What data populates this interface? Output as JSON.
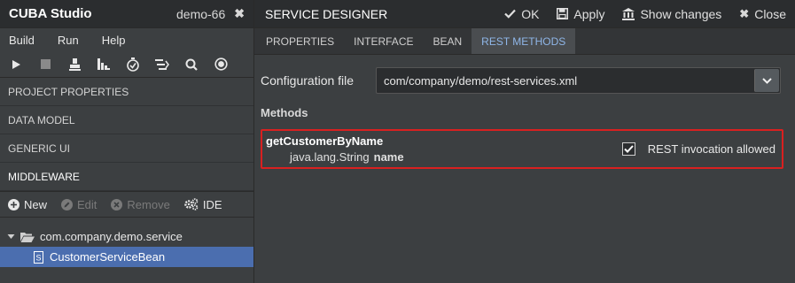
{
  "app": {
    "title": "CUBA Studio",
    "project": "demo-66"
  },
  "menu": [
    "Build",
    "Run",
    "Help"
  ],
  "toolbar_icons": [
    "play-icon",
    "stop-icon",
    "deploy-icon",
    "build-icon",
    "check-icon",
    "list-icon",
    "search-icon",
    "record-icon"
  ],
  "sections": [
    {
      "label": "PROJECT PROPERTIES"
    },
    {
      "label": "DATA MODEL"
    },
    {
      "label": "GENERIC UI"
    },
    {
      "label": "MIDDLEWARE"
    }
  ],
  "middleware_actions": {
    "new": "New",
    "edit": "Edit",
    "remove": "Remove",
    "ide": "IDE"
  },
  "tree": {
    "package": "com.company.demo.service",
    "service": "CustomerServiceBean"
  },
  "designer": {
    "title": "SERVICE DESIGNER",
    "ok": "OK",
    "apply": "Apply",
    "show_changes": "Show changes",
    "close": "Close"
  },
  "tabs": [
    {
      "label": "PROPERTIES"
    },
    {
      "label": "INTERFACE"
    },
    {
      "label": "BEAN"
    },
    {
      "label": "REST METHODS"
    }
  ],
  "config": {
    "label": "Configuration file",
    "value": "com/company/demo/rest-services.xml"
  },
  "methods": {
    "label": "Methods",
    "items": [
      {
        "name": "getCustomerByName",
        "param_type": "java.lang.String",
        "param_name": "name",
        "rest_label": "REST invocation allowed",
        "rest_allowed": true
      }
    ]
  },
  "colors": {
    "accent": "#4b6eaf",
    "highlight_border": "#d92020",
    "active_tab_text": "#8fb6e8"
  }
}
